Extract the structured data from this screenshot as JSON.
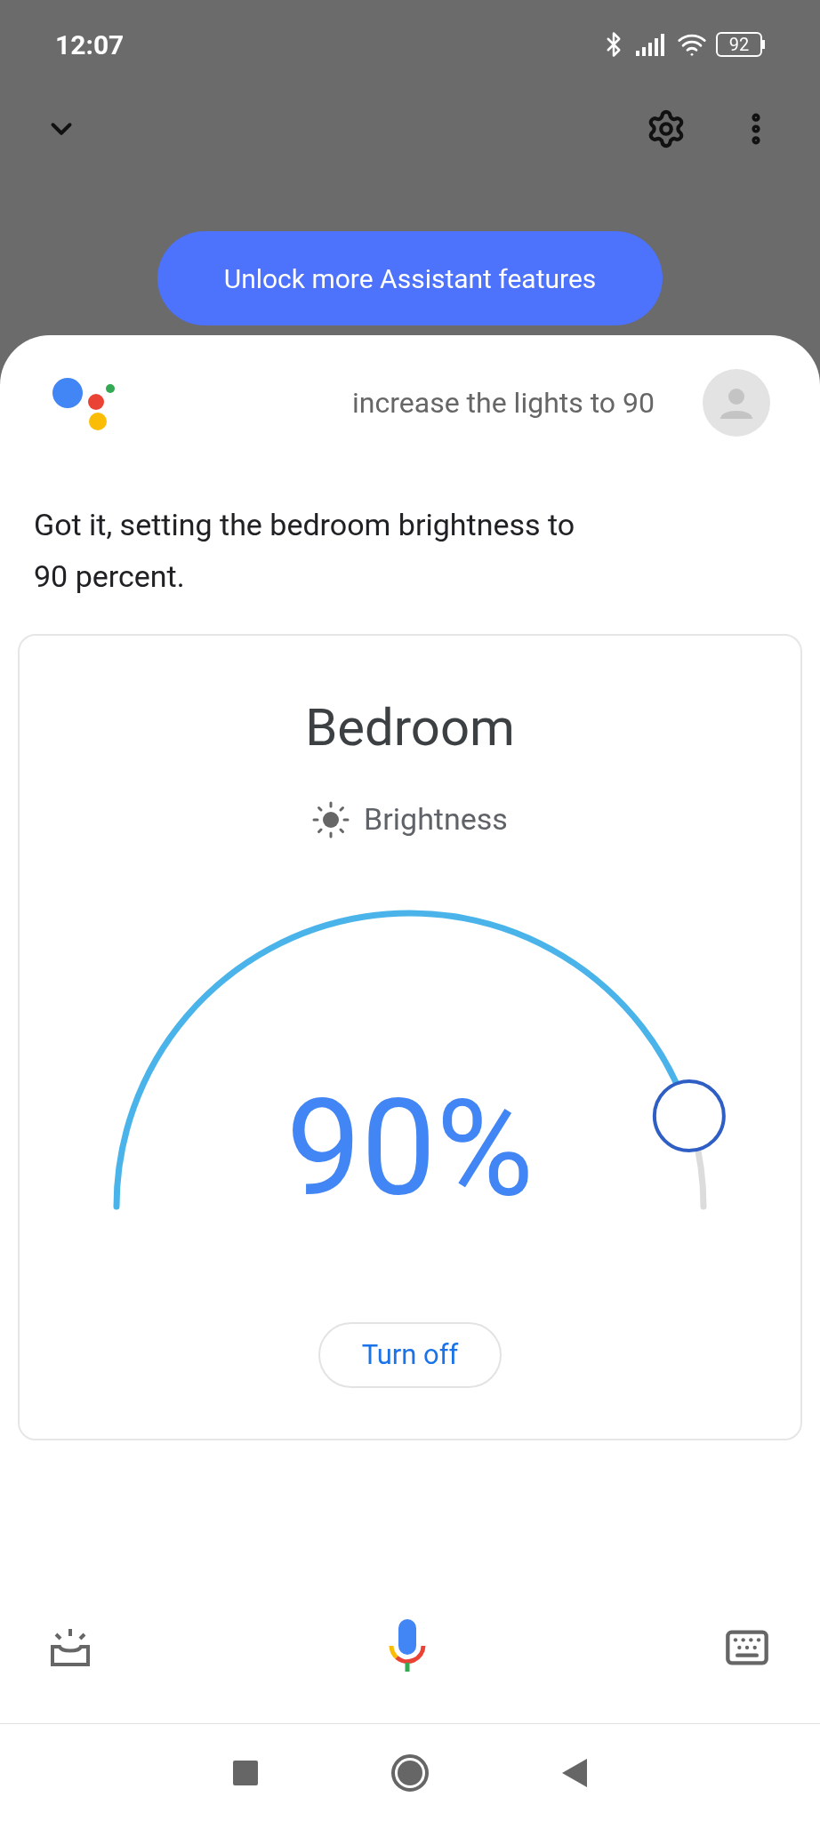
{
  "status_bar": {
    "time": "12:07",
    "battery": "92"
  },
  "banner": {
    "label": "Unlock more Assistant features"
  },
  "assistant": {
    "query": "increase the lights to 90",
    "response": "Got it, setting the bedroom brightness to 90 percent."
  },
  "card": {
    "title": "Bedroom",
    "control_label": "Brightness",
    "dial": {
      "level": 0.9,
      "reading": "90%"
    },
    "button": "Turn off"
  }
}
